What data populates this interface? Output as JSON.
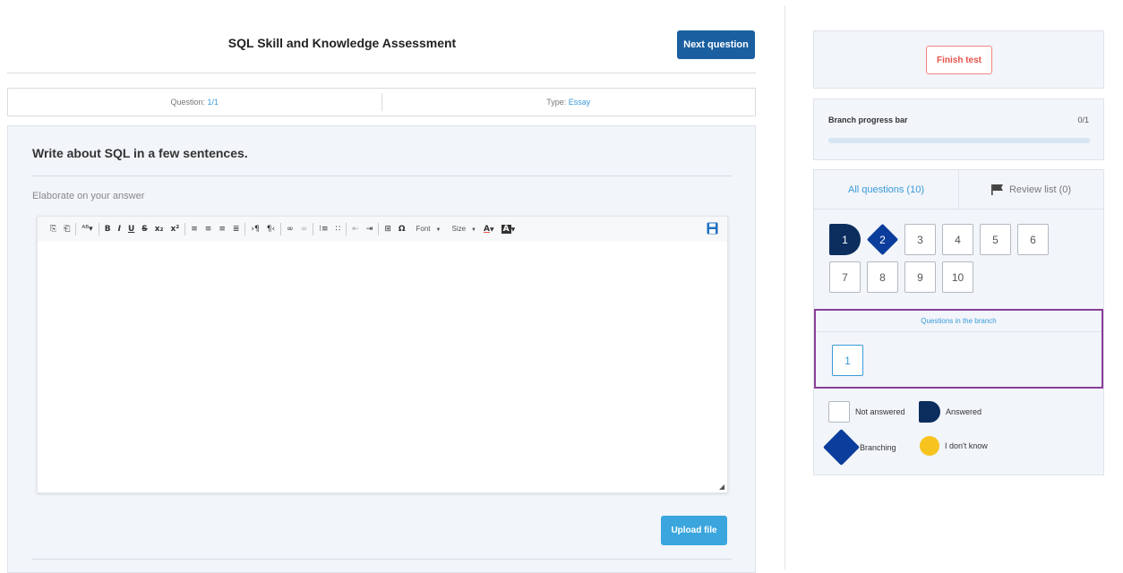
{
  "header": {
    "title": "SQL Skill and Knowledge Assessment",
    "next_label": "Next question"
  },
  "info": {
    "question_label": "Question: ",
    "question_value": "1/1",
    "type_label": "Type: ",
    "type_value": "Essay"
  },
  "question": {
    "text": "Write about SQL in a few sentences.",
    "hint": "Elaborate on your answer",
    "upload_label": "Upload file"
  },
  "toolbar": {
    "buttons": {
      "bold": "B",
      "italic": "I",
      "underline": "U",
      "strike": "S",
      "subscript": "x₂",
      "superscript": "x²",
      "special_char": "Ω"
    },
    "font_label": "Font",
    "size_label": "Size",
    "font_color": "A",
    "bg_color": "A"
  },
  "sidebar": {
    "finish_label": "Finish test",
    "progress": {
      "label": "Branch progress bar",
      "count": "0/1",
      "fraction": 0
    },
    "tabs": {
      "all": "All questions (10)",
      "review": "Review list (0)"
    },
    "questions": [
      {
        "n": "1",
        "state": "answered"
      },
      {
        "n": "2",
        "state": "branching"
      },
      {
        "n": "3",
        "state": "not-answered"
      },
      {
        "n": "4",
        "state": "not-answered"
      },
      {
        "n": "5",
        "state": "not-answered"
      },
      {
        "n": "6",
        "state": "not-answered"
      },
      {
        "n": "7",
        "state": "not-answered"
      },
      {
        "n": "8",
        "state": "not-answered"
      },
      {
        "n": "9",
        "state": "not-answered"
      },
      {
        "n": "10",
        "state": "not-answered"
      }
    ],
    "branch": {
      "title": "Questions in the branch",
      "items": [
        "1"
      ]
    },
    "legend": {
      "not_answered": "Not answered",
      "answered": "Answered",
      "branching": "Branching",
      "dont_know": "I don't know"
    },
    "colors": {
      "primary": "#1a5fa0",
      "accent": "#3a9bd9",
      "answered": "#0b2e5e",
      "branching": "#0a3d9c",
      "dont_know": "#f7c31f",
      "danger": "#e5534a",
      "highlight_border": "#8a3f98"
    }
  }
}
